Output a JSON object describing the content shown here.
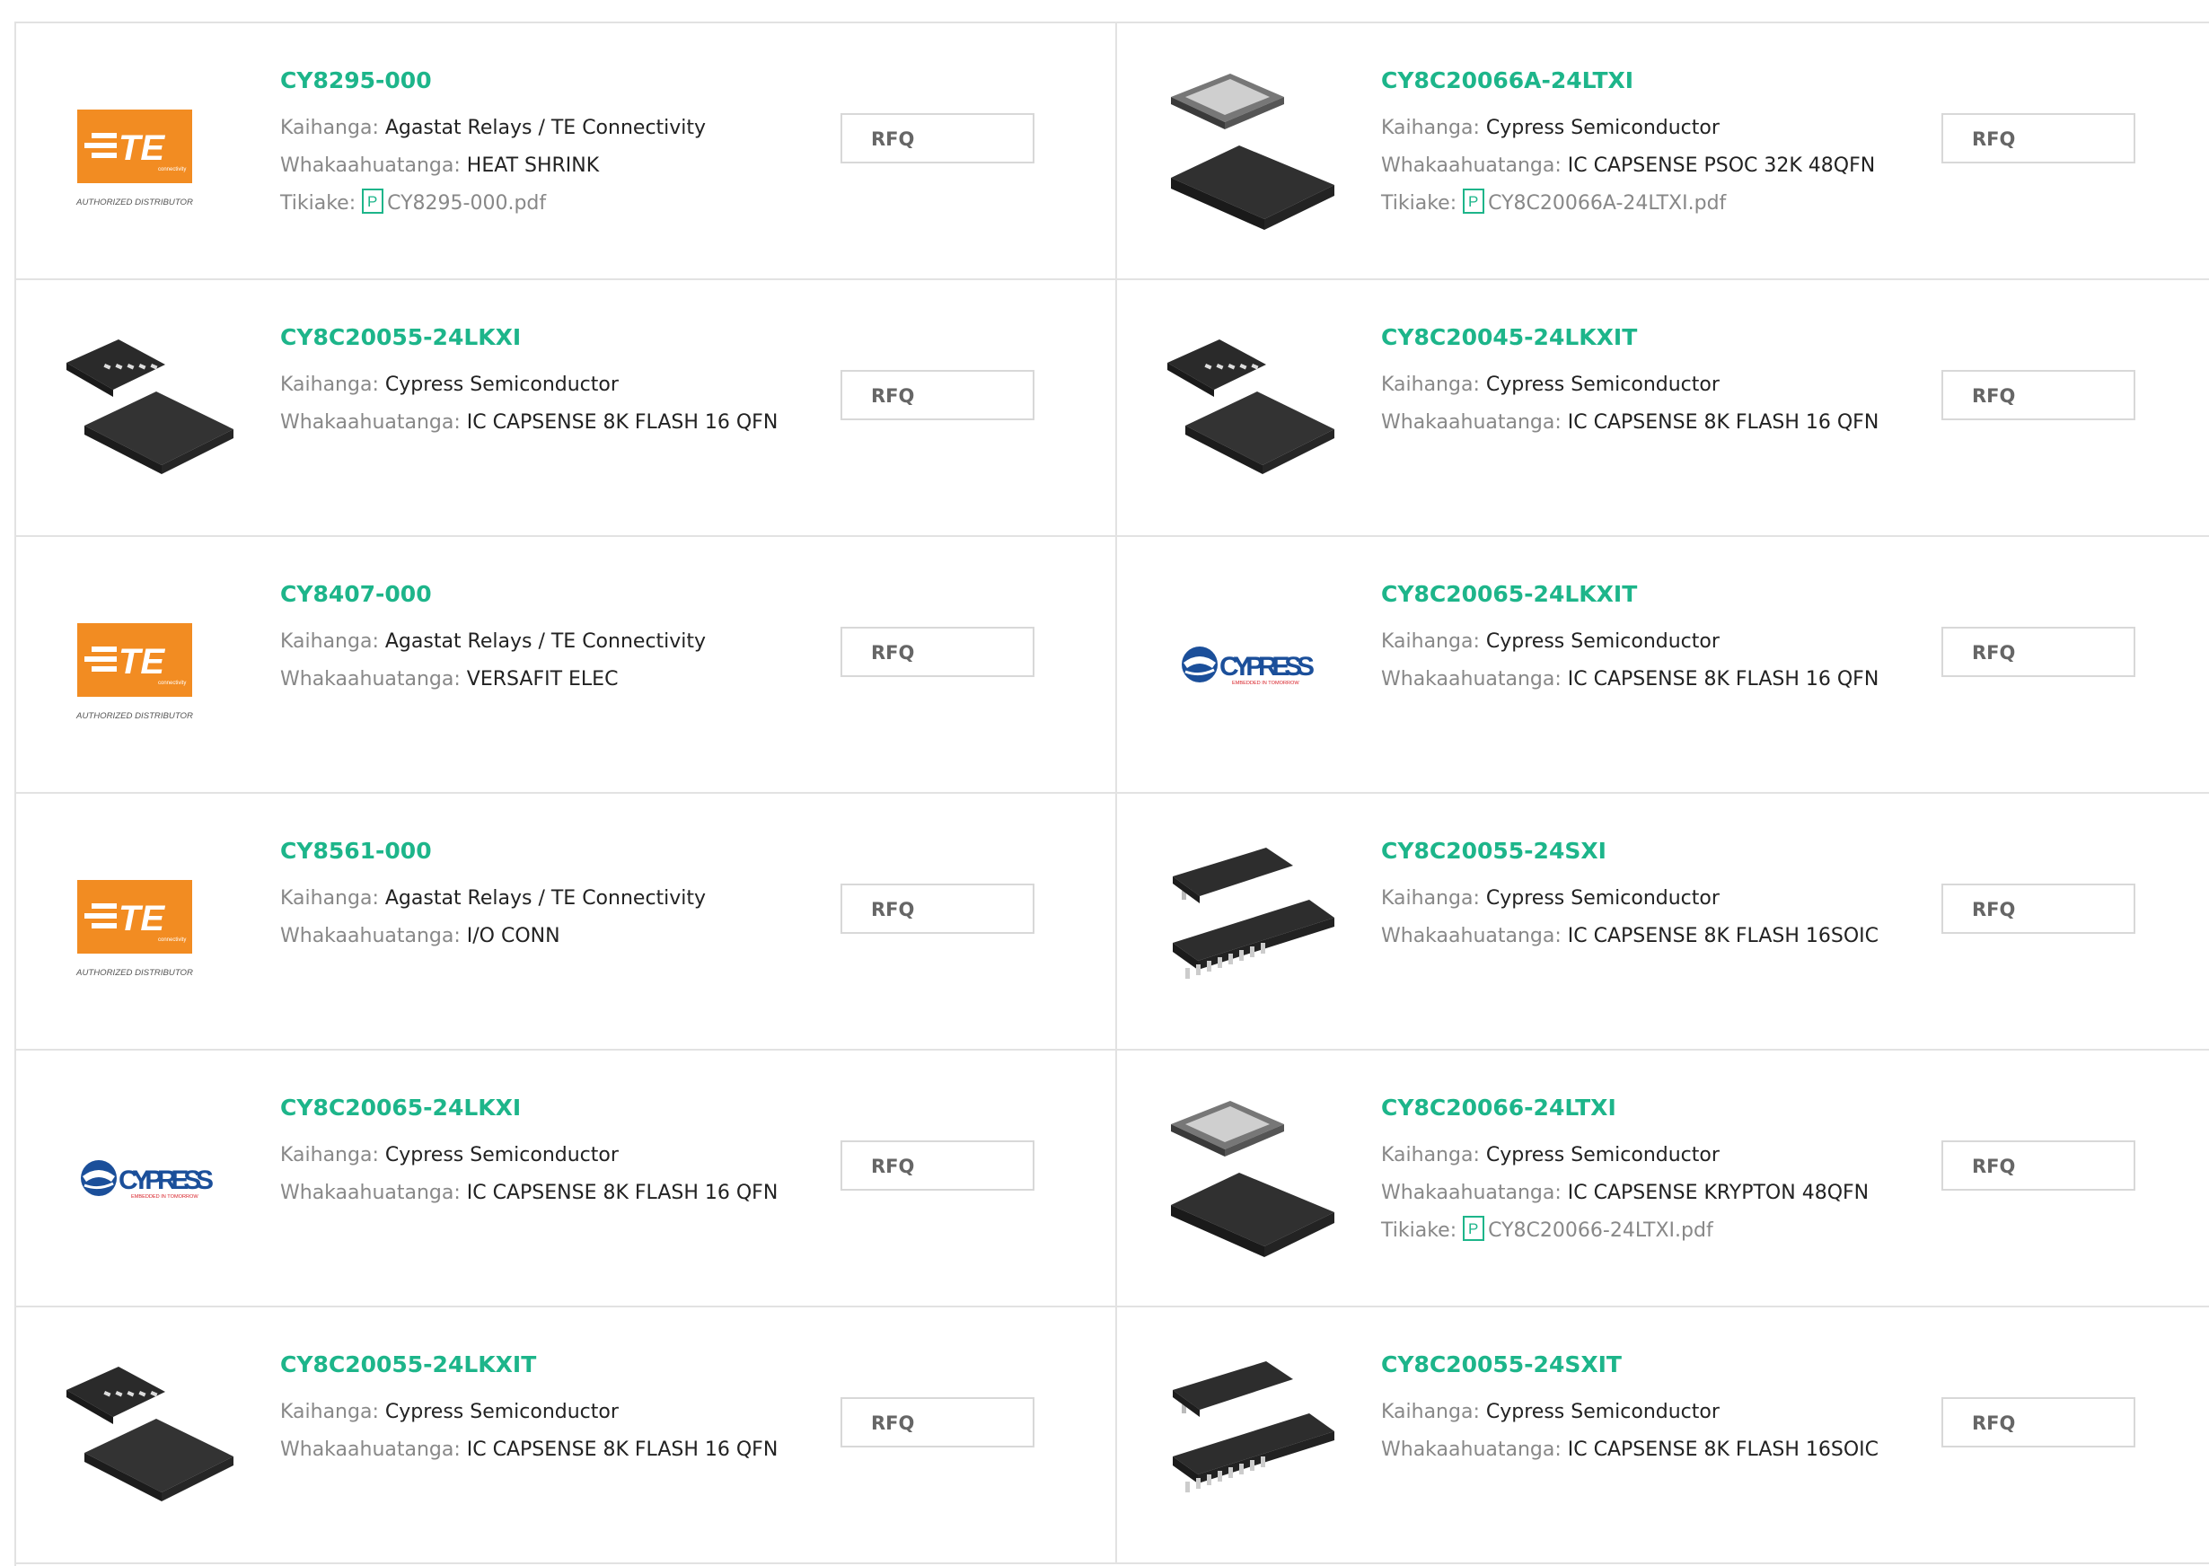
{
  "labels": {
    "manufacturer": "Kaihanga",
    "description": "Whakaahuatanga",
    "datasheet": "Tikiake",
    "rfq": "RFQ"
  },
  "products": [
    {
      "part": "CY8295-000",
      "manufacturer": "Agastat Relays / TE Connectivity",
      "description": "HEAT SHRINK",
      "datasheet": "CY8295-000.pdf",
      "image": "te-logo",
      "image_text": "AUTHORIZED DISTRIBUTOR"
    },
    {
      "part": "CY8C20066A-24LTXI",
      "manufacturer": "Cypress Semiconductor",
      "description": "IC CAPSENSE PSOC 32K 48QFN",
      "datasheet": "CY8C20066A-24LTXI.pdf",
      "image": "qfn48-chip"
    },
    {
      "part": "CY8C20055-24LKXI",
      "manufacturer": "Cypress Semiconductor",
      "description": "IC CAPSENSE 8K FLASH 16 QFN",
      "datasheet": "",
      "image": "qfn16-chip"
    },
    {
      "part": "CY8C20045-24LKXIT",
      "manufacturer": "Cypress Semiconductor",
      "description": "IC CAPSENSE 8K FLASH 16 QFN",
      "datasheet": "",
      "image": "qfn16-chip"
    },
    {
      "part": "CY8407-000",
      "manufacturer": "Agastat Relays / TE Connectivity",
      "description": "VERSAFIT ELEC",
      "datasheet": "",
      "image": "te-logo",
      "image_text": "AUTHORIZED DISTRIBUTOR"
    },
    {
      "part": "CY8C20065-24LKXIT",
      "manufacturer": "Cypress Semiconductor",
      "description": "IC CAPSENSE 8K FLASH 16 QFN",
      "datasheet": "",
      "image": "cypress-logo",
      "image_text": "CYPRESS"
    },
    {
      "part": "CY8561-000",
      "manufacturer": "Agastat Relays / TE Connectivity",
      "description": "I/O CONN",
      "datasheet": "",
      "image": "te-logo",
      "image_text": "AUTHORIZED DISTRIBUTOR"
    },
    {
      "part": "CY8C20055-24SXI",
      "manufacturer": "Cypress Semiconductor",
      "description": "IC CAPSENSE 8K FLASH 16SOIC",
      "datasheet": "",
      "image": "soic-chip"
    },
    {
      "part": "CY8C20065-24LKXI",
      "manufacturer": "Cypress Semiconductor",
      "description": "IC CAPSENSE 8K FLASH 16 QFN",
      "datasheet": "",
      "image": "cypress-logo",
      "image_text": "CYPRESS"
    },
    {
      "part": "CY8C20066-24LTXI",
      "manufacturer": "Cypress Semiconductor",
      "description": "IC CAPSENSE KRYPTON 48QFN",
      "datasheet": "CY8C20066-24LTXI.pdf",
      "image": "qfn48-chip"
    },
    {
      "part": "CY8C20055-24LKXIT",
      "manufacturer": "Cypress Semiconductor",
      "description": "IC CAPSENSE 8K FLASH 16 QFN",
      "datasheet": "",
      "image": "qfn16-chip"
    },
    {
      "part": "CY8C20055-24SXIT",
      "manufacturer": "Cypress Semiconductor",
      "description": "IC CAPSENSE 8K FLASH 16SOIC",
      "datasheet": "",
      "image": "soic-chip"
    }
  ],
  "colors": {
    "part_link": "#1db58a",
    "te_orange": "#f28c22",
    "cypress_blue": "#1b4f9a",
    "pdf_green": "#1db58a",
    "border": "#e2e2e2"
  }
}
